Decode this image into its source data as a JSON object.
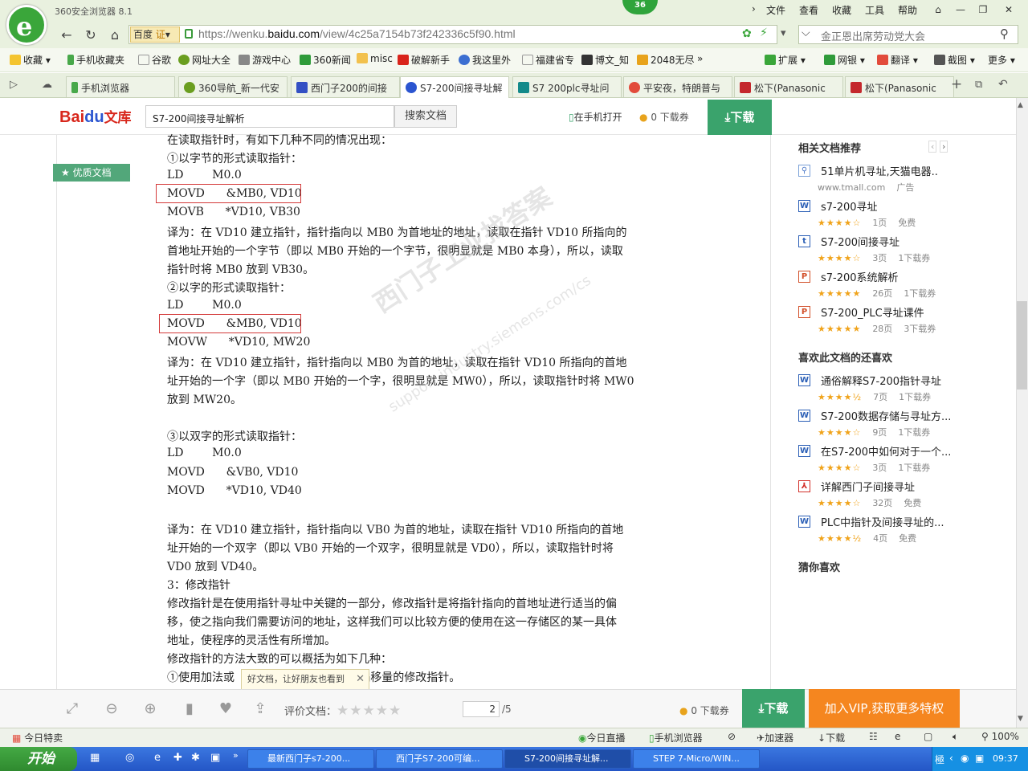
{
  "window": {
    "title": "360安全浏览器 8.1",
    "badge": "36",
    "menu": [
      "文件",
      "查看",
      "收藏",
      "工具",
      "帮助"
    ]
  },
  "address": {
    "engine": "百度",
    "engine_badge": "证",
    "url_prefix": "https://wenku.",
    "url_domain": "baidu.com",
    "url_path": "/view/4c25a7154b73f242336c5f90.html",
    "search_placeholder": "金正恩出席劳动党大会"
  },
  "bookmarks": {
    "left": [
      "收藏",
      "手机收藏夹",
      "谷歌",
      "网址大全",
      "游戏中心",
      "360新闻",
      "misc",
      "破解新手",
      "我这里外",
      "福建省专",
      "博文_知",
      "2048无尽"
    ],
    "right": [
      "扩展",
      "网银",
      "翻译",
      "截图",
      "更多"
    ]
  },
  "tabs": [
    {
      "label": "手机浏览器",
      "active": false
    },
    {
      "label": "360导航_新一代安",
      "active": false
    },
    {
      "label": "西门子200的间接",
      "active": false
    },
    {
      "label": "S7-200间接寻址解",
      "active": true
    },
    {
      "label": "S7 200plc寻址问",
      "active": false
    },
    {
      "label": "平安夜，特朗普与",
      "active": false
    },
    {
      "label": "松下(Panasonic",
      "active": false
    },
    {
      "label": "松下(Panasonic",
      "active": false
    }
  ],
  "baidu": {
    "logo_a": "Bai",
    "logo_b": "du",
    "logo_c": "文库",
    "search_value": "S7-200间接寻址解析",
    "search_button": "搜索文档",
    "phone_open": "在手机打开",
    "download_count": "0 下载券",
    "download_button": "下载"
  },
  "document": {
    "quality_tag": "优质文档",
    "lines": [
      "在读取指针时，有如下几种不同的情况出现：",
      "①以字节的形式读取指针：",
      "LD        M0.0",
      "MOVD      &MB0, VD10",
      "MOVB      *VD10, VB30",
      "译为：在 VD10 建立指针，指针指向以 MB0 为首地址的地址，读取在指针 VD10 所指向的",
      "首地址开始的一个字节（即以 MB0 开始的一个字节，很明显就是 MB0 本身），所以，读取",
      "指针时将 MB0 放到 VB30。",
      "②以字的形式读取指针：",
      "LD        M0.0",
      "MOVD      &MB0, VD10",
      "MOVW      *VD10, MW20",
      "译为：在 VD10 建立指针，指针指向以 MB0 为首的地址，读取在指针 VD10 所指向的首地",
      "址开始的一个字（即以 MB0 开始的一个字，很明显就是 MW0），所以，读取指针时将 MW0",
      "放到 MW20。",
      "",
      "③以双字的形式读取指针：",
      "LD        M0.0",
      "MOVD      &VB0, VD10",
      "MOVD      *VD10, VD40",
      "",
      "译为：在 VD10 建立指针，指针指向以 VB0 为首的地址，读取在指针 VD10 所指向的首地",
      "址开始的一个双字（即以 VB0 开始的一个双字，很明显就是 VD0），所以，读取指针时将",
      "VD0 放到 VD40。",
      "3：修改指针",
      "修改指针是在使用指针寻址中关键的一部分，修改指针是将指针指向的首地址进行适当的偏",
      "移，使之指向我们需要访问的地址，这样我们可以比较方便的使用在这一存储区的某一具体",
      "地址，使程序的灵活性有所增加。",
      "修改指针的方法大致的可以概括为如下几种：",
      "①使用加法或                指定常数作为偏移量的修改指针。"
    ],
    "watermark": "西门子工业找答案",
    "watermark_url": "support.industry.siemens.com/cs",
    "tooltip": "好文档，让好朋友也看到"
  },
  "related": {
    "title": "相关文档推荐",
    "items": [
      {
        "icon": "ad",
        "name": "51单片机寻址,天猫电器..",
        "meta": "www.tmall.com    广告"
      },
      {
        "icon": "W",
        "name": "s7-200寻址",
        "stars": "★★★★☆",
        "pages": "1页",
        "dl": "免费"
      },
      {
        "icon": "t",
        "name": "S7-200间接寻址",
        "stars": "★★★★☆",
        "pages": "3页",
        "dl": "1下载券"
      },
      {
        "icon": "P",
        "name": "s7-200系统解析",
        "stars": "★★★★★",
        "pages": "26页",
        "dl": "1下载券"
      },
      {
        "icon": "P",
        "name": "S7-200_PLC寻址课件",
        "stars": "★★★★★",
        "pages": "28页",
        "dl": "3下载券"
      }
    ]
  },
  "liked": {
    "title": "喜欢此文档的还喜欢",
    "items": [
      {
        "icon": "W",
        "name": "通俗解释S7-200指针寻址",
        "stars": "★★★★½",
        "pages": "7页",
        "dl": "1下载券"
      },
      {
        "icon": "W",
        "name": "S7-200数据存储与寻址方...",
        "stars": "★★★★☆",
        "pages": "9页",
        "dl": "1下载券"
      },
      {
        "icon": "W",
        "name": "在S7-200中如何对于一个...",
        "stars": "★★★★☆",
        "pages": "3页",
        "dl": "1下载券"
      },
      {
        "icon": "pdf",
        "name": "详解西门子间接寻址",
        "stars": "★★★★☆",
        "pages": "32页",
        "dl": "免费"
      },
      {
        "icon": "W",
        "name": "PLC中指针及间接寻址的...",
        "stars": "★★★★½",
        "pages": "4页",
        "dl": "免费"
      }
    ]
  },
  "guess_title": "猜你喜欢",
  "toolbar": {
    "rate_label": "评价文档：",
    "rate_stars": "★★★★★",
    "page_current": "2",
    "page_total": "/5",
    "download_count": "0 下载券",
    "download_button": "下载",
    "vip_button": "加入VIP,获取更多特权"
  },
  "statusbar": {
    "left": "今日特卖",
    "items": [
      "今日直播",
      "手机浏览器",
      "加速器",
      "下载"
    ],
    "zoom": "100%"
  },
  "taskbar": {
    "start": "开始",
    "tasks": [
      {
        "label": "最新西门子s7-200...",
        "active": false
      },
      {
        "label": "西门子S7-200可编...",
        "active": false
      },
      {
        "label": "S7-200间接寻址解...",
        "active": true
      },
      {
        "label": "STEP 7-Micro/WIN...",
        "active": false
      }
    ],
    "clock": "09:37"
  },
  "colors": {
    "green": "#3aa36c",
    "orange": "#f5861f",
    "red_box": "#d43a3a",
    "star": "#f0a31a"
  }
}
